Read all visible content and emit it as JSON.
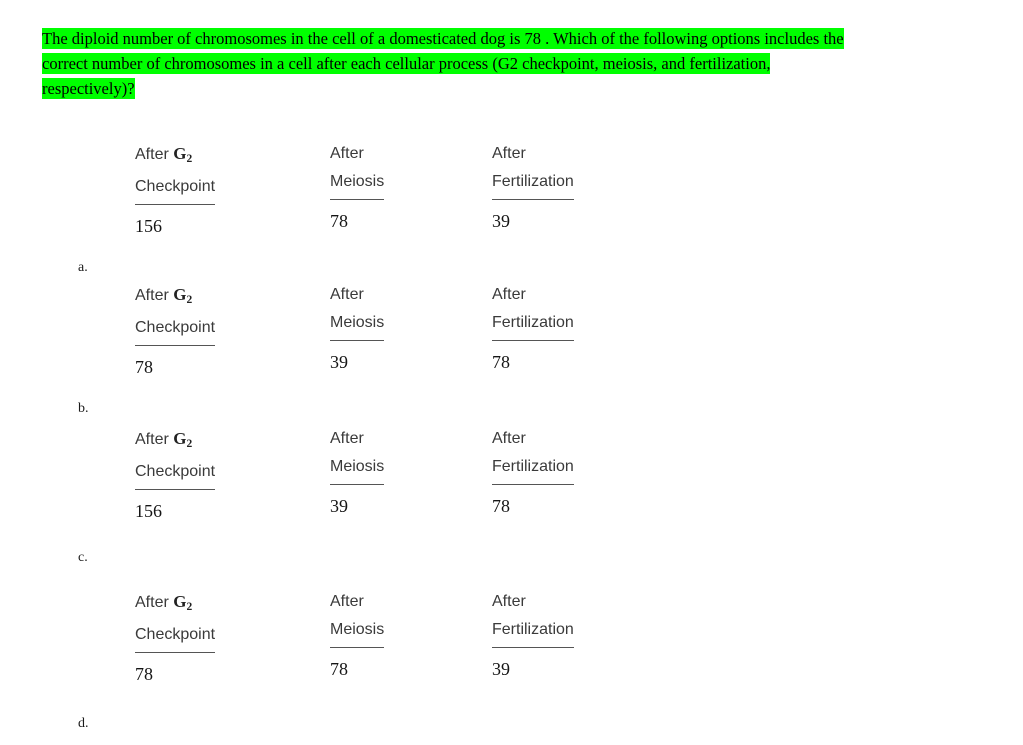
{
  "page": {
    "background_color": "#ffffff",
    "highlight_color": "#00FF00"
  },
  "question": {
    "lines": [
      "The diploid number of chromosomes in the cell of a domesticated dog is 78 . Which of the following options includes the",
      "correct number of chromosomes in a cell after each cellular process (G2 checkpoint, meiosis, and fertilization,",
      "respectively)?"
    ]
  },
  "headers": {
    "col1_line1": "After",
    "col1_g": "G",
    "col1_g_sub": "2",
    "col1_line2": "Checkpoint",
    "col2_line1": "After",
    "col2_line2": "Meiosis",
    "col3_line1": "After",
    "col3_line2": "Fertilization"
  },
  "options": [
    {
      "letter": "a.",
      "after_g2_checkpoint": "156",
      "after_meiosis": "78",
      "after_fertilization": "39"
    },
    {
      "letter": "b.",
      "after_g2_checkpoint": "78",
      "after_meiosis": "39",
      "after_fertilization": "78"
    },
    {
      "letter": "c.",
      "after_g2_checkpoint": "156",
      "after_meiosis": "39",
      "after_fertilization": "78"
    },
    {
      "letter": "d.",
      "after_g2_checkpoint": "78",
      "after_meiosis": "78",
      "after_fertilization": "39"
    }
  ]
}
